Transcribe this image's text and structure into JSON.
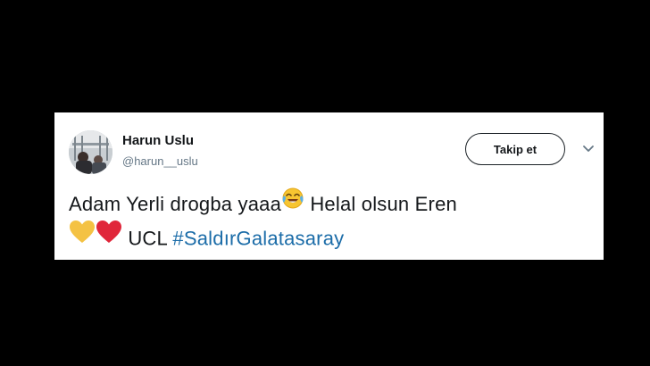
{
  "tweet": {
    "author_name": "Harun Uslu",
    "author_handle": "@harun__uslu",
    "follow_label": "Takip et",
    "line1_text": "Adam Yerli drogba yaaa",
    "line1_text_after_emoji": " Helal olsun Eren",
    "line2_text": "UCL ",
    "hashtag": "#SaldırGalatasaray",
    "emojis": [
      "face-with-tears-of-joy-icon",
      "yellow-heart-icon",
      "red-heart-icon"
    ]
  },
  "colors": {
    "background": "#000000",
    "card": "#ffffff",
    "text": "#14171a",
    "secondary_text": "#657786",
    "hashtag": "#1b6ca8",
    "yellow_heart": "#f4c243",
    "red_heart": "#e0263a"
  }
}
